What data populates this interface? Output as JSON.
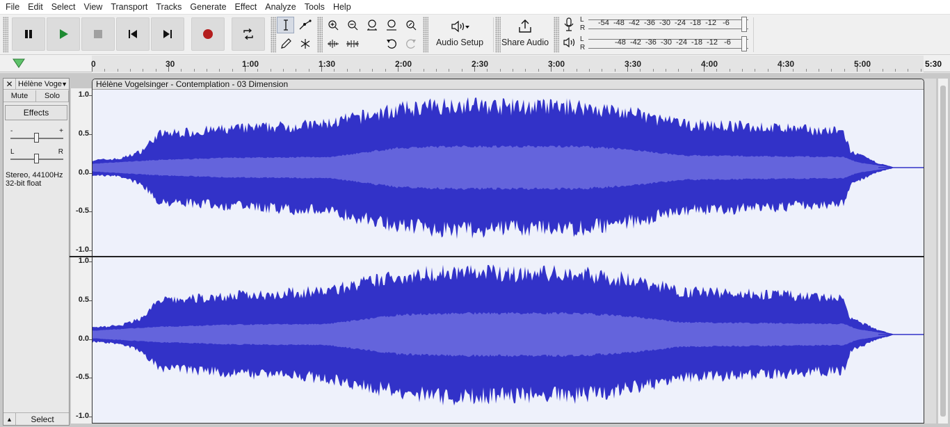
{
  "menu": [
    "File",
    "Edit",
    "Select",
    "View",
    "Transport",
    "Tracks",
    "Generate",
    "Effect",
    "Analyze",
    "Tools",
    "Help"
  ],
  "toolbar": {
    "transport": [
      "pause-icon",
      "play-icon",
      "stop-icon",
      "skip-start-icon",
      "skip-end-icon",
      "record-icon",
      "loop-icon"
    ],
    "audio_setup_label": "Audio Setup",
    "share_audio_label": "Share Audio",
    "record_meter_ticks": "-54  -48  -42  -36  -30  -24  -18  -12   -6",
    "play_meter_ticks": "-48  -42  -36  -30  -24  -18  -12   -6",
    "meter_l": "L",
    "meter_r": "R"
  },
  "timeline": {
    "labels": [
      "0",
      "30",
      "1:00",
      "1:30",
      "2:00",
      "2:30",
      "3:00",
      "3:30",
      "4:00",
      "4:30",
      "5:00"
    ],
    "end_label": "5:30",
    "seconds_max": 330
  },
  "track": {
    "name": "Hélène Voge",
    "mute_label": "Mute",
    "solo_label": "Solo",
    "effects_label": "Effects",
    "gain_minus": "-",
    "gain_plus": "+",
    "pan_left": "L",
    "pan_right": "R",
    "info_line1": "Stereo, 44100Hz",
    "info_line2": "32-bit float",
    "select_label": "Select",
    "clip_title": "Hélène Vogelsinger - Contemplation - 03 Dimension",
    "scale_labels": [
      "1.0",
      "0.5",
      "0.0",
      "-0.5",
      "-1.0"
    ]
  },
  "colors": {
    "waveform_peak": "#3232c8",
    "waveform_rms": "#6464dc",
    "clip_bg": "#eef1fb"
  }
}
